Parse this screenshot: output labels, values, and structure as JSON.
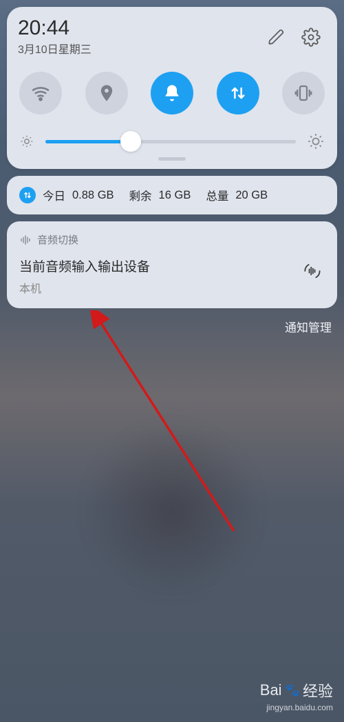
{
  "status": {
    "time": "20:44",
    "date": "3月10日星期三"
  },
  "toggles": {
    "wifi": "wifi",
    "location": "location",
    "bell": "bell",
    "data": "data",
    "vibrate": "vibrate"
  },
  "brightness": {
    "percent": 34
  },
  "data_usage": {
    "today_label": "今日",
    "today_value": "0.88 GB",
    "remain_label": "剩余",
    "remain_value": "16 GB",
    "total_label": "总量",
    "total_value": "20 GB"
  },
  "notification": {
    "app_name": "音频切换",
    "title": "当前音频输入输出设备",
    "subtitle": "本机"
  },
  "links": {
    "manage": "通知管理"
  },
  "watermark": {
    "brand_prefix": "Bai",
    "brand_suffix": "经验",
    "url": "jingyan.baidu.com"
  }
}
